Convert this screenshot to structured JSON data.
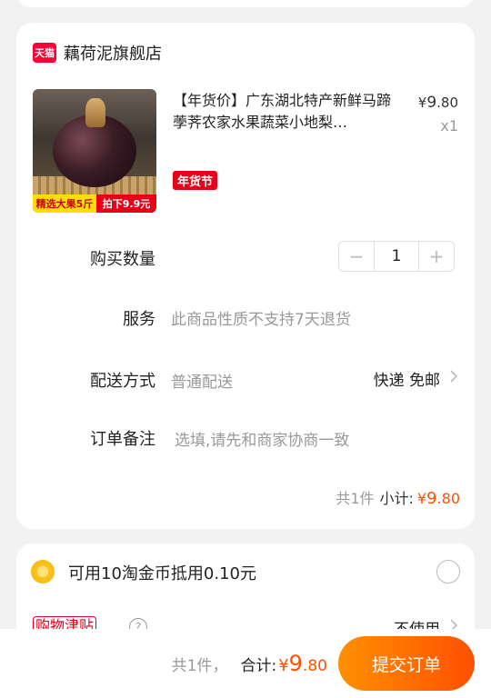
{
  "shop": {
    "badge": "天猫",
    "name": "藕荷泥旗舰店"
  },
  "product": {
    "title": "【年货价】广东湖北特产新鲜马蹄荸荠农家水果蔬菜小地梨…",
    "price_symbol": "¥",
    "price_int": "9",
    "price_dec": ".80",
    "quantity": "x1",
    "festival_tag": "年货节",
    "img_tag_left": "精选大果5斤",
    "img_tag_right": "拍下9.9元"
  },
  "rows": {
    "qty_label": "购买数量",
    "qty_value": "1",
    "qty_minus": "−",
    "qty_plus": "+",
    "service_label": "服务",
    "service_value": "此商品性质不支持7天退货",
    "delivery_label": "配送方式",
    "delivery_value": "普通配送",
    "delivery_right": "快递 免邮",
    "note_label": "订单备注",
    "note_placeholder": "选填,请先和商家协商一致"
  },
  "subtotal": {
    "count": "共1件",
    "label": "小计:",
    "symbol": "¥",
    "int": "9",
    "dec": ".80"
  },
  "coin": {
    "text": "可用10淘金币抵用0.10元"
  },
  "subsidy": {
    "tag": "购物津贴",
    "help": "?",
    "right": "不使用"
  },
  "footer": {
    "count": "共1件，",
    "label": "合计:",
    "symbol": "¥",
    "int": "9",
    "dec": ".80",
    "submit": "提交订单"
  },
  "colors": {
    "accent": "#ff5000",
    "brand_red": "#e8001a"
  }
}
